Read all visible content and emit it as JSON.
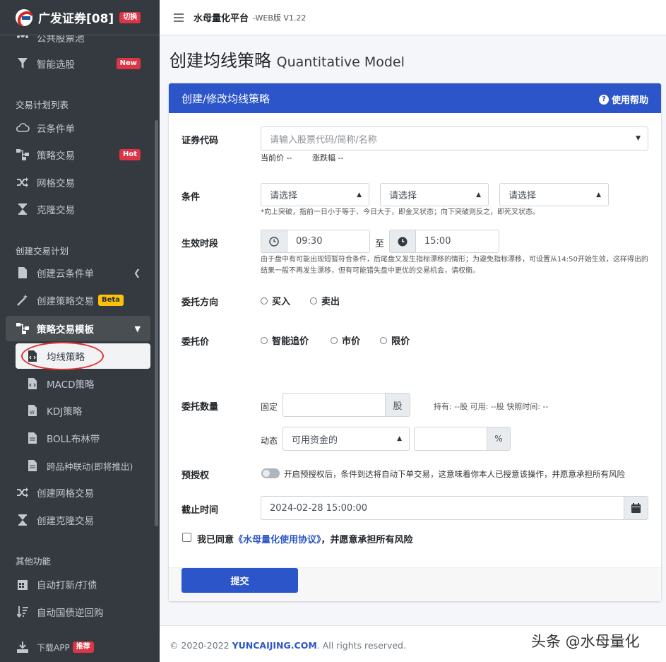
{
  "brand": {
    "name": "广发证券[08]",
    "switch": "切换"
  },
  "sidebar": {
    "items_top": [
      {
        "label": "公共股票池",
        "icon": "group-icon"
      },
      {
        "label": "智能选股",
        "icon": "filter-icon",
        "badge": "New"
      }
    ],
    "section_plan": "交易计划列表",
    "plan_items": [
      {
        "label": "云条件单",
        "icon": "cloud-icon"
      },
      {
        "label": "策略交易",
        "icon": "sitemap-icon",
        "badge": "Hot"
      },
      {
        "label": "网格交易",
        "icon": "shuffle-icon"
      },
      {
        "label": "克隆交易",
        "icon": "hourglass-icon"
      }
    ],
    "section_create": "创建交易计划",
    "create_items": [
      {
        "label": "创建云条件单",
        "icon": "file-icon"
      },
      {
        "label": "创建策略交易",
        "icon": "magic-icon",
        "badge": "Beta"
      },
      {
        "label": "策略交易模板",
        "icon": "sitemap-icon"
      }
    ],
    "template_items": [
      {
        "label": "均线策略",
        "icon": "file-code-icon"
      },
      {
        "label": "MACD策略",
        "icon": "file-code-icon"
      },
      {
        "label": "KDJ策略",
        "icon": "file-word-icon"
      },
      {
        "label": "BOLL布林带",
        "icon": "file-icon"
      },
      {
        "label": "跨品种联动(即将推出)",
        "icon": "file-icon"
      }
    ],
    "create_more": [
      {
        "label": "创建网格交易",
        "icon": "shuffle-icon"
      },
      {
        "label": "创建克隆交易",
        "icon": "hourglass-icon"
      }
    ],
    "section_other": "其他功能",
    "other_items": [
      {
        "label": "自动打新/打债",
        "icon": "calendar-icon"
      },
      {
        "label": "自动国债逆回购",
        "icon": "sort-icon"
      },
      {
        "label": "下载APP",
        "icon": "download-icon",
        "badge": "推荐"
      }
    ]
  },
  "topbar": {
    "title": "水母量化平台",
    "version": "-WEB版 V1.22"
  },
  "page": {
    "title": "创建均线策略",
    "subtitle": "Quantitative Model"
  },
  "card": {
    "header": "创建/修改均线策略",
    "help": "使用帮助"
  },
  "form": {
    "code_label": "证券代码",
    "code_placeholder": "请输入股票代码/简称/名称",
    "current_price": "当前价 --",
    "change": "涨跌幅 --",
    "cond_label": "条件",
    "cond_selects": [
      "请选择",
      "请选择",
      "请选择"
    ],
    "cond_note": "*向上突破，指前一日小于等于、今日大于，即金叉状态；向下突破则反之，即死叉状态。",
    "time_label": "生效时段",
    "time_start": "09:30",
    "time_to": "至",
    "time_end": "15:00",
    "time_note": "由于盘中有可能出现短暂符合条件，后尾盘又发生指标漂移的情形；为避免指标漂移，可设置从14:50开始生效，这样得出的结果一般不再发生漂移，但有可能错失盘中更优的交易机会，请权衡。",
    "dir_label": "委托方向",
    "dir_options": [
      "买入",
      "卖出"
    ],
    "price_label": "委托价",
    "price_options": [
      "智能追价",
      "市价",
      "限价"
    ],
    "qty_label": "委托数量",
    "fixed_label": "固定",
    "fixed_unit": "股",
    "holding": "持有: --股   可用: --股   快照时间: --",
    "dynamic_label": "动态",
    "dynamic_select": "可用资金的",
    "pct_unit": "%",
    "preauth_label": "预授权",
    "preauth_text": "开启预授权后，条件到达将自动下单交易，这意味着你本人已授意该操作，并愿意承担所有风险",
    "deadline_label": "截止时间",
    "deadline_value": "2024-02-28 15:00:00",
    "agree_prefix": "我已同意",
    "agree_link": "《水母量化使用协议》",
    "agree_suffix": "，并愿意承担所有风险",
    "submit": "提交"
  },
  "footer": {
    "copyright": "© 2020-2022 ",
    "site": "YUNCAIJING.COM",
    "rights": ". All rights reserved."
  },
  "watermark": "头条 @水母量化"
}
